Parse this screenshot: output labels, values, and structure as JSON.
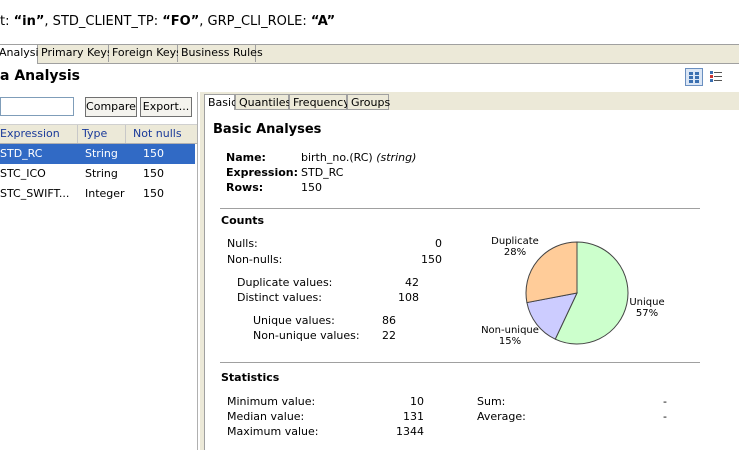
{
  "filter": {
    "part1": "t: ",
    "val1": "“in”",
    "part2": ",  STD_CLIENT_TP: ",
    "val2": "“FO”",
    "part3": ",  GRP_CLI_ROLE: ",
    "val3": "“A”"
  },
  "main_tabs": [
    "Analysis",
    "Primary Keys",
    "Foreign Keys",
    "Business Rules"
  ],
  "section_title": "a Analysis",
  "toolbar": {
    "compare_label": "Compare",
    "export_label": "Export..."
  },
  "table": {
    "headers": [
      "Expression",
      "Type",
      "Not nulls"
    ],
    "rows": [
      {
        "expression": "STD_RC",
        "type": "String",
        "not_nulls": "150"
      },
      {
        "expression": "STC_ICO",
        "type": "String",
        "not_nulls": "150"
      },
      {
        "expression": "STC_SWIFT...",
        "type": "Integer",
        "not_nulls": "150"
      }
    ]
  },
  "sub_tabs": [
    "Basic",
    "Quantiles",
    "Frequency",
    "Groups"
  ],
  "basic": {
    "title": "Basic Analyses",
    "name_label": "Name:",
    "name_value": "birth_no.(RC)",
    "name_type": "(string)",
    "expression_label": "Expression:",
    "expression_value": "STD_RC",
    "rows_label": "Rows:",
    "rows_value": "150"
  },
  "counts": {
    "title": "Counts",
    "nulls_label": "Nulls:",
    "nulls": "0",
    "nonnulls_label": "Non-nulls:",
    "nonnulls": "150",
    "duplicate_label": "Duplicate values:",
    "duplicate": "42",
    "distinct_label": "Distinct values:",
    "distinct": "108",
    "unique_label": "Unique values:",
    "unique": "86",
    "nonunique_label": "Non-unique values:",
    "nonunique": "22"
  },
  "chart_data": {
    "type": "pie",
    "slices": [
      {
        "label": "Unique",
        "percent_label": "57%",
        "value": 57,
        "color": "#ccffcc"
      },
      {
        "label": "Non-unique",
        "percent_label": "15%",
        "value": 15,
        "color": "#ccccff"
      },
      {
        "label": "Duplicate",
        "percent_label": "28%",
        "value": 28,
        "color": "#ffcc99"
      }
    ]
  },
  "statistics": {
    "title": "Statistics",
    "min_label": "Minimum value:",
    "min": "10",
    "median_label": "Median value:",
    "median": "131",
    "max_label": "Maximum value:",
    "max": "1344",
    "sum_label": "Sum:",
    "sum": "-",
    "avg_label": "Average:",
    "avg": "-"
  },
  "colors": {
    "selection": "#316ac5",
    "panel": "#ece9d8",
    "header_text": "#1a3a9a"
  }
}
